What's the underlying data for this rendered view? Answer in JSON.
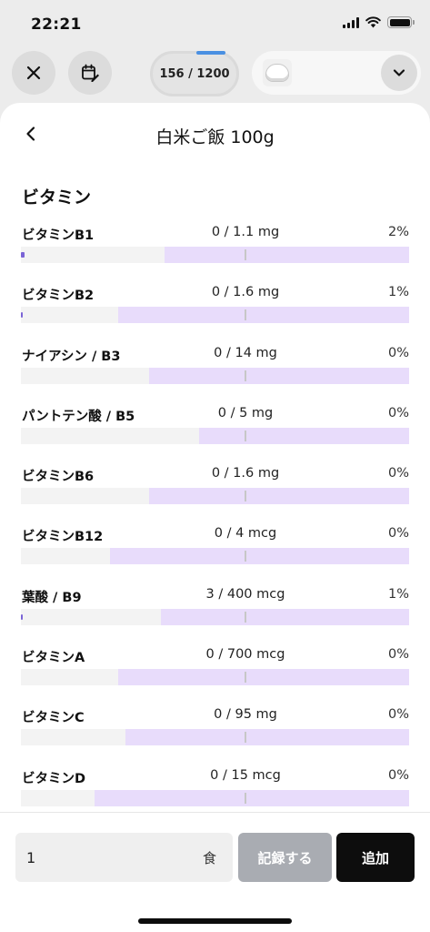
{
  "status_bar": {
    "time": "22:21"
  },
  "top_bar": {
    "progress_text": "156 / 1200"
  },
  "sheet": {
    "title": "白米ご飯 100g",
    "section_title": "ビタミン"
  },
  "nutrients": [
    {
      "name": "ビタミンB1",
      "amount": "0 / 1.1 mg",
      "percent": "2%",
      "progress": 0.02,
      "target_start": 0.37
    },
    {
      "name": "ビタミンB2",
      "amount": "0 / 1.6 mg",
      "percent": "1%",
      "progress": 0.01,
      "target_start": 0.25
    },
    {
      "name": "ナイアシン / B3",
      "amount": "0 / 14 mg",
      "percent": "0%",
      "progress": 0,
      "target_start": 0.33
    },
    {
      "name": "パントテン酸 / B5",
      "amount": "0 / 5 mg",
      "percent": "0%",
      "progress": 0,
      "target_start": 0.46
    },
    {
      "name": "ビタミンB6",
      "amount": "0 / 1.6 mg",
      "percent": "0%",
      "progress": 0,
      "target_start": 0.33
    },
    {
      "name": "ビタミンB12",
      "amount": "0 / 4 mcg",
      "percent": "0%",
      "progress": 0,
      "target_start": 0.23
    },
    {
      "name": "葉酸 / B9",
      "amount": "3 / 400 mcg",
      "percent": "1%",
      "progress": 0.01,
      "target_start": 0.36
    },
    {
      "name": "ビタミンA",
      "amount": "0 / 700 mcg",
      "percent": "0%",
      "progress": 0,
      "target_start": 0.25
    },
    {
      "name": "ビタミンC",
      "amount": "0 / 95 mg",
      "percent": "0%",
      "progress": 0,
      "target_start": 0.27
    },
    {
      "name": "ビタミンD",
      "amount": "0 / 15 mcg",
      "percent": "0%",
      "progress": 0,
      "target_start": 0.19
    }
  ],
  "bottom_bar": {
    "quantity_value": "1",
    "quantity_unit": "食",
    "record_label": "記録する",
    "add_label": "追加"
  },
  "colors": {
    "target_band": "#e8dcfb",
    "progress_fill": "#7a64d6",
    "add_button": "#0d0d0d",
    "record_button": "#a9acb2"
  },
  "icons": {
    "close": "close-icon",
    "calendar": "calendar-edit-icon",
    "food": "rice-bowl-icon",
    "dropdown": "chevron-down-icon",
    "back": "chevron-left-icon"
  }
}
